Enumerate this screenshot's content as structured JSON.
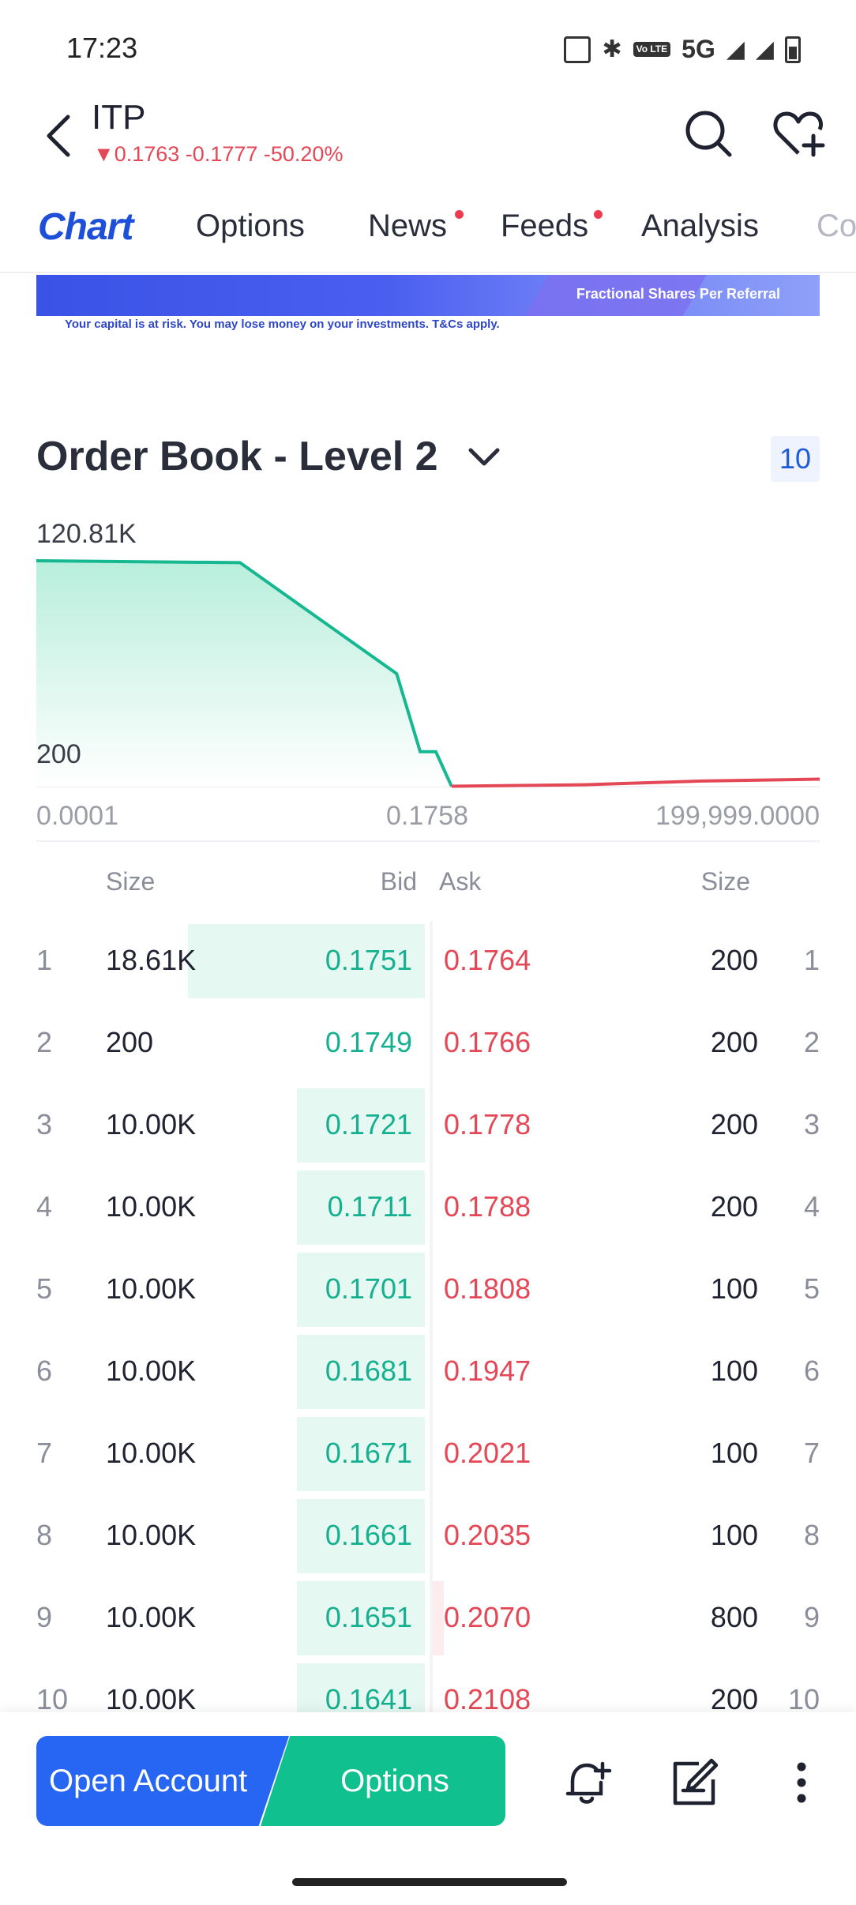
{
  "status_bar": {
    "time": "17:23",
    "network": "5G",
    "volte": "Vo LTE",
    "icons": [
      "nfc-icon",
      "bluetooth-icon",
      "volte-icon",
      "signal-icon",
      "signal-icon",
      "battery-icon"
    ]
  },
  "header": {
    "symbol": "ITP",
    "quote": "▼0.1763 -0.1777 -50.20%",
    "quote_color": "#e44755"
  },
  "tabs": [
    {
      "label": "Chart",
      "active": true
    },
    {
      "label": "Options"
    },
    {
      "label": "News",
      "badge": true
    },
    {
      "label": "Feeds",
      "badge": true
    },
    {
      "label": "Analysis"
    },
    {
      "label": "Co"
    }
  ],
  "banner": {
    "text": "Fractional Shares Per Referral",
    "disclaimer": "Your capital is at risk. You may lose money on your investments. T&Cs apply."
  },
  "order_book": {
    "title": "Order Book - Level 2",
    "depth": "10",
    "columns": {
      "size_left": "Size",
      "bid": "Bid",
      "ask": "Ask",
      "size_right": "Size"
    },
    "rows": [
      {
        "idx": "1",
        "bid_size": "18.61K",
        "bid": "0.1751",
        "ask": "0.1764",
        "ask_size": "200",
        "bid_share": 1.0,
        "ask_share": 0.0
      },
      {
        "idx": "2",
        "bid_size": "200",
        "bid": "0.1749",
        "ask": "0.1766",
        "ask_size": "200",
        "bid_share": 0.0,
        "ask_share": 0.0
      },
      {
        "idx": "3",
        "bid_size": "10.00K",
        "bid": "0.1721",
        "ask": "0.1778",
        "ask_size": "200",
        "bid_share": 0.54,
        "ask_share": 0.0
      },
      {
        "idx": "4",
        "bid_size": "10.00K",
        "bid": "0.1711",
        "ask": "0.1788",
        "ask_size": "200",
        "bid_share": 0.54,
        "ask_share": 0.0
      },
      {
        "idx": "5",
        "bid_size": "10.00K",
        "bid": "0.1701",
        "ask": "0.1808",
        "ask_size": "100",
        "bid_share": 0.54,
        "ask_share": 0.0
      },
      {
        "idx": "6",
        "bid_size": "10.00K",
        "bid": "0.1681",
        "ask": "0.1947",
        "ask_size": "100",
        "bid_share": 0.54,
        "ask_share": 0.0
      },
      {
        "idx": "7",
        "bid_size": "10.00K",
        "bid": "0.1671",
        "ask": "0.2021",
        "ask_size": "100",
        "bid_share": 0.54,
        "ask_share": 0.0
      },
      {
        "idx": "8",
        "bid_size": "10.00K",
        "bid": "0.1661",
        "ask": "0.2035",
        "ask_size": "100",
        "bid_share": 0.54,
        "ask_share": 0.0
      },
      {
        "idx": "9",
        "bid_size": "10.00K",
        "bid": "0.1651",
        "ask": "0.2070",
        "ask_size": "800",
        "bid_share": 0.54,
        "ask_share": 0.04
      },
      {
        "idx": "10",
        "bid_size": "10.00K",
        "bid": "0.1641",
        "ask": "0.2108",
        "ask_size": "200",
        "bid_share": 0.54,
        "ask_share": 0.0
      }
    ]
  },
  "chart_data": {
    "type": "area",
    "title": "",
    "y_tick_labels": [
      "120.81K",
      "200"
    ],
    "x_tick_labels": [
      "0.0001",
      "0.1758",
      "199,999.0000"
    ],
    "series": [
      {
        "name": "",
        "color": "#15b890",
        "shape": [
          {
            "x": 0.0,
            "y": 120.0
          },
          {
            "x": 0.26,
            "y": 119.0
          },
          {
            "x": 0.46,
            "y": 60.0
          },
          {
            "x": 0.49,
            "y": 18.6
          },
          {
            "x": 0.51,
            "y": 18.6
          },
          {
            "x": 0.53,
            "y": 0.2
          }
        ]
      },
      {
        "name": "",
        "color": "#e44755",
        "shape": [
          {
            "x": 0.53,
            "y": 0.2
          },
          {
            "x": 0.7,
            "y": 1.0
          },
          {
            "x": 0.85,
            "y": 3.0
          },
          {
            "x": 1.0,
            "y": 4.0
          }
        ]
      }
    ],
    "legend": "none",
    "grid": false
  },
  "bottom_bar": {
    "open_account": "Open Account",
    "options": "Options",
    "icons": [
      "bell-plus-icon",
      "note-edit-icon",
      "more-vertical-icon"
    ]
  }
}
